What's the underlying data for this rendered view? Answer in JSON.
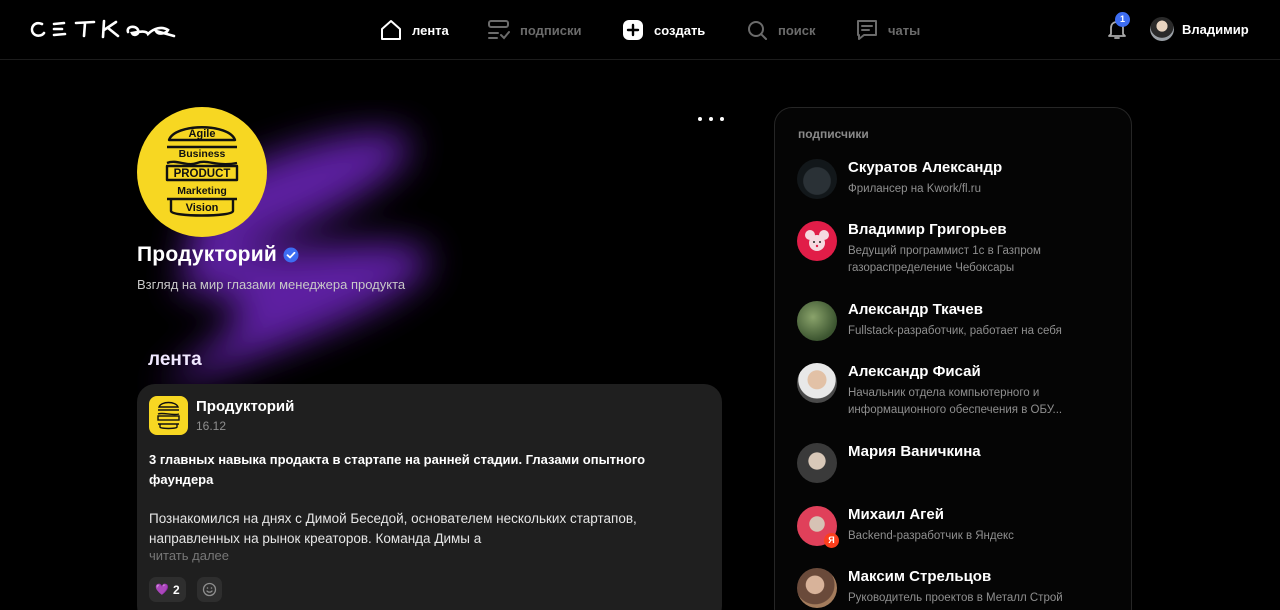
{
  "header": {
    "logo_text": "СЕТКА",
    "nav": {
      "feed": "лента",
      "subscriptions": "подписки",
      "create": "создать",
      "search": "поиск",
      "chats": "чаты"
    },
    "notifications_count": "1",
    "user_name": "Владимир"
  },
  "profile": {
    "name": "Продукторий",
    "description": "Взгляд на мир глазами менеджера продукта",
    "logo_words": [
      "Agile",
      "Business",
      "PRODUCT",
      "Marketing",
      "Vision"
    ]
  },
  "feed": {
    "title": "лента",
    "post": {
      "author": "Продукторий",
      "date": "16.12",
      "headline": "3 главных навыка продакта в стартапе на ранней стадии. Глазами опытного фаундера",
      "body": "Познакомился на днях с Димой Беседой, основателем нескольких стартапов, направленных на рынок креаторов. Команда Димы а",
      "read_more": "читать далее",
      "reaction_count": "2"
    }
  },
  "subscribers": {
    "title": "подписчики",
    "items": [
      {
        "name": "Скуратов Александр",
        "role": "Фрилансер на Kwork/fl.ru"
      },
      {
        "name": "Владимир Григорьев",
        "role": "Ведущий программист 1с в Газпром газораспределение Чебоксары"
      },
      {
        "name": "Александр Ткачев",
        "role": "Fullstack-разработчик, работает на себя"
      },
      {
        "name": "Александр Фисай",
        "role": "Начальник отдела компьютерного и информационного обеспечения в ОБУ..."
      },
      {
        "name": "Мария Ваничкина",
        "role": ""
      },
      {
        "name": "Михаил Агей",
        "role": "Backend-разработчик в Яндекс"
      },
      {
        "name": "Максим Стрельцов",
        "role": "Руководитель проектов в Металл Строй"
      }
    ]
  },
  "colors": {
    "background": "#000000",
    "accent_glow": "#8a2be2",
    "verified": "#3d6df2",
    "brand_yellow": "#f7d722"
  }
}
